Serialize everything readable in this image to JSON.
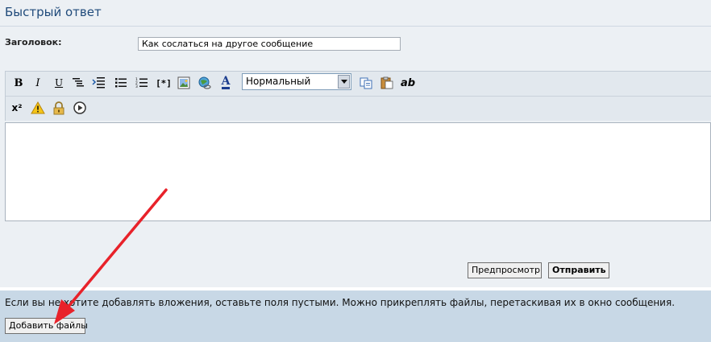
{
  "header": {
    "title": "Быстрый ответ"
  },
  "subject": {
    "label": "Заголовок:",
    "value": "Как сослаться на другое сообщение"
  },
  "toolbar": {
    "row1": [
      {
        "name": "bold-icon",
        "glyph": "B"
      },
      {
        "name": "italic-icon",
        "glyph": "I"
      },
      {
        "name": "underline-icon",
        "glyph": "U"
      },
      {
        "name": "align-icon",
        "glyph": ""
      },
      {
        "name": "indent-icon",
        "glyph": ""
      },
      {
        "name": "bullet-list-icon",
        "glyph": ""
      },
      {
        "name": "numbered-list-icon",
        "glyph": ""
      },
      {
        "name": "list-item-icon",
        "glyph": "[*]"
      },
      {
        "name": "image-icon",
        "glyph": ""
      },
      {
        "name": "link-icon",
        "glyph": ""
      },
      {
        "name": "font-color-icon",
        "glyph": "A"
      }
    ],
    "font_size_select": "Нормальный",
    "row1_after": [
      {
        "name": "copy-icon",
        "glyph": ""
      },
      {
        "name": "paste-icon",
        "glyph": ""
      },
      {
        "name": "spellcheck-icon",
        "glyph": "ab"
      }
    ],
    "row2": [
      {
        "name": "superscript-icon",
        "glyph": "x²"
      },
      {
        "name": "warning-icon",
        "glyph": "!"
      },
      {
        "name": "lock-icon",
        "glyph": ""
      },
      {
        "name": "play-icon",
        "glyph": ""
      }
    ]
  },
  "editor": {
    "value": ""
  },
  "actions": {
    "preview_label": "Предпросмотр",
    "submit_label": "Отправить"
  },
  "attachments": {
    "note": "Если вы не хотите добавлять вложения, оставьте поля пустыми. Можно прикреплять файлы, перетаскивая их в окно сообщения.",
    "add_button_label": "Добавить файлы"
  },
  "colors": {
    "arrow": "#E8222A",
    "title": "#1F4A7A",
    "panel": "#C8D8E6"
  }
}
